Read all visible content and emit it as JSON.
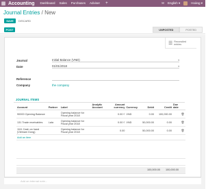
{
  "navbar": {
    "app_name": "Accounting",
    "menus": [
      "Dashboard",
      "Sales",
      "Purchases",
      "Adviser"
    ],
    "plus": "+",
    "language": "English",
    "user": "Hoàng"
  },
  "breadcrumb": {
    "parent": "Journal Entries",
    "separator": "/",
    "current": "New"
  },
  "buttons": {
    "save": "SAVE",
    "discard": "DISCARD",
    "post": "POST"
  },
  "statusbar": {
    "states": [
      "UNPOSTED",
      "POSTED"
    ],
    "active": "UNPOSTED"
  },
  "smart_button": {
    "label_1": "Reconciled",
    "label_2": "entries"
  },
  "form": {
    "journal_label": "Journal",
    "journal_value": "Initial Balance (VND)",
    "date_label": "Date",
    "date_value": "01/01/2018",
    "reference_label": "Reference",
    "reference_value": "",
    "company_label": "Company",
    "company_value": "the company"
  },
  "tab": {
    "label": "JOURNAL ITEMS"
  },
  "table": {
    "columns": [
      "Account",
      "Partner",
      "Label",
      "Analytic Account",
      "Amount currency",
      "Currency",
      "Debit",
      "Credit",
      "Due date"
    ],
    "rows": [
      {
        "account": "90000 Opening Balance",
        "partner": "",
        "label": "Opening balance for Fiscal year 2018",
        "analytic": "",
        "amount_currency": "0.00 ₫",
        "currency": "VND",
        "debit": "0.00",
        "credit": "100,000.00",
        "due_date": ""
      },
      {
        "account": "131 Trade receivables",
        "partner": "Lala",
        "label": "Opening balance for Fiscal year 2018",
        "analytic": "",
        "amount_currency": "0.00 ₫",
        "currency": "VND",
        "debit": "50,000.00",
        "credit": "0.00",
        "due_date": ""
      },
      {
        "account": "1111 Cash on hand (Vietnam Dong)",
        "partner": "",
        "label": "Opening balance for Fiscal year 2018",
        "analytic": "",
        "amount_currency": "0.00",
        "currency": "",
        "debit": "50,000.00",
        "credit": "0.00",
        "due_date": ""
      }
    ],
    "add_line": "Add an item",
    "total_debit": "100,000.00",
    "total_credit": "100,000.00"
  },
  "note_placeholder": "Add an internal note..."
}
